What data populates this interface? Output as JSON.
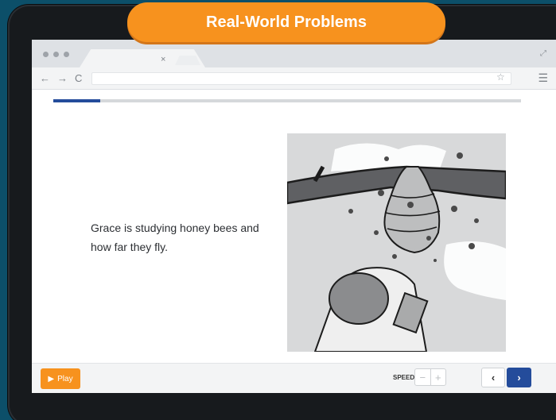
{
  "header": {
    "title": "Real-World Problems"
  },
  "browser": {
    "close_glyph": "×",
    "back": "←",
    "forward": "→",
    "reload": "C",
    "star": "☆",
    "menu": "☰",
    "expand": "⤢"
  },
  "lesson": {
    "progress": 0.1,
    "text": "Grace is studying honey bees and how far they fly.",
    "illustration": "beekeeper-with-clipboard-under-beehive"
  },
  "controls": {
    "play_label": "Play",
    "speed_label": "SPEED",
    "speed_minus": "−",
    "speed_plus": "+",
    "prev": "‹",
    "next": "›"
  },
  "colors": {
    "accent": "#f7921e",
    "primary": "#244c9b",
    "background": "#0c4f69"
  }
}
